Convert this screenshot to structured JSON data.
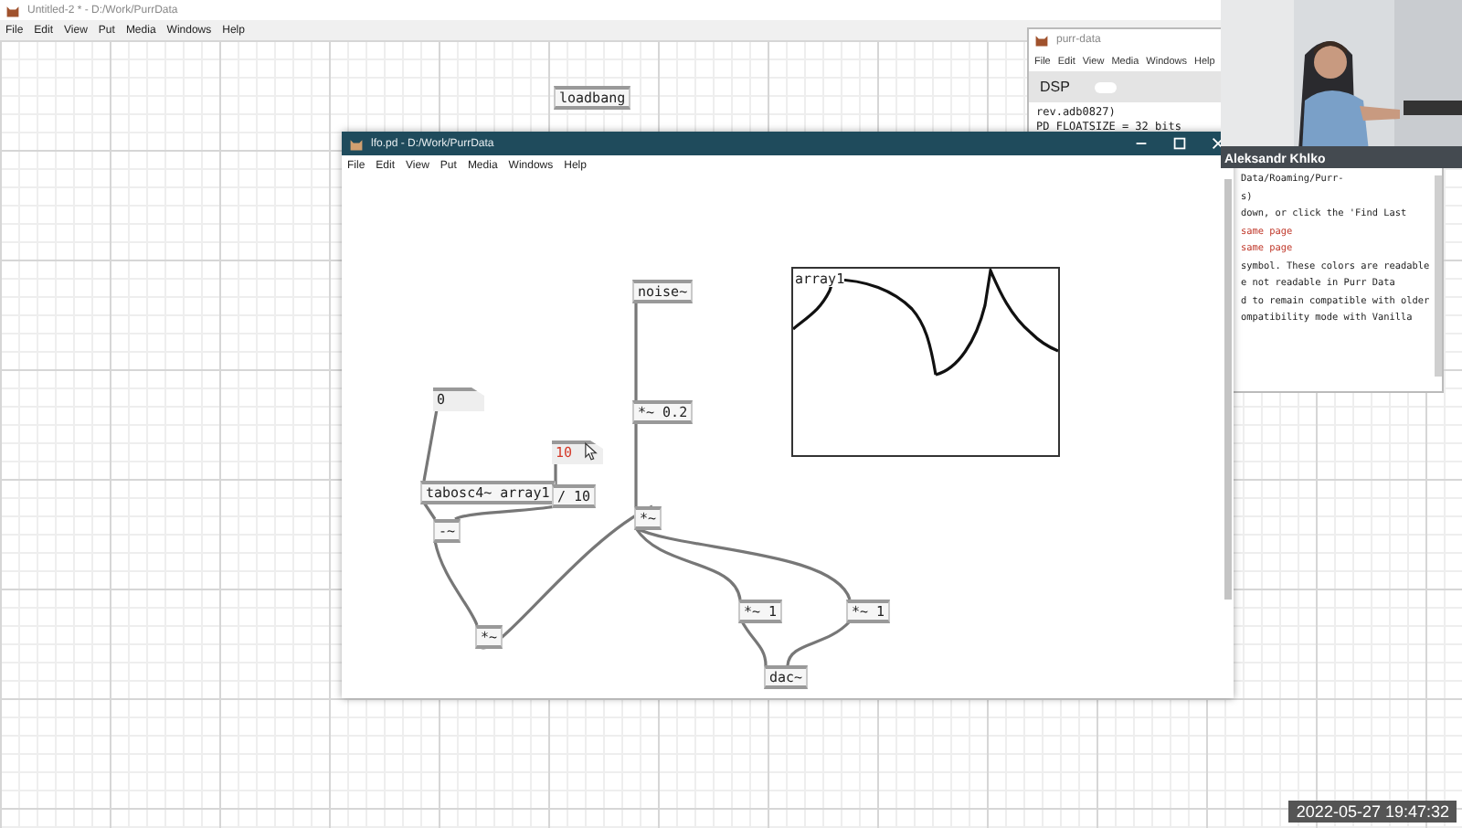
{
  "background_window": {
    "title": "Untitled-2 * - D:/Work/PurrData",
    "menu": [
      "File",
      "Edit",
      "View",
      "Put",
      "Media",
      "Windows",
      "Help"
    ],
    "objects": [
      {
        "kind": "object",
        "text": "loadbang"
      }
    ]
  },
  "console_window": {
    "title": "purr-data",
    "menu": [
      "File",
      "Edit",
      "View",
      "Media",
      "Windows",
      "Help"
    ],
    "dsp": {
      "label": "DSP",
      "on": false
    },
    "left_lines": [
      "rev.adb0827)",
      "PD_FLOATSIZE = 32 bits"
    ],
    "right_lines": [
      {
        "kind": "normal",
        "text": "Data/Roaming/Purr-"
      },
      {
        "kind": "normal",
        "text": "s)"
      },
      {
        "kind": "normal",
        "text": "down, or click the 'Find Last"
      },
      {
        "kind": "error",
        "text": "same page"
      },
      {
        "kind": "error",
        "text": "same page"
      },
      {
        "kind": "normal",
        "text": "symbol. These colors are readable"
      },
      {
        "kind": "normal",
        "text": "e not readable in Purr Data"
      },
      {
        "kind": "normal",
        "text": "d to remain compatible with older"
      },
      {
        "kind": "normal",
        "text": "ompatibility mode with Vanilla"
      }
    ]
  },
  "patch_window": {
    "title": "lfo.pd - D:/Work/PurrData",
    "menu": [
      "File",
      "Edit",
      "View",
      "Put",
      "Media",
      "Windows",
      "Help"
    ],
    "objects": [
      {
        "kind": "object",
        "text": "noise~"
      },
      {
        "kind": "object",
        "text": "*~ 0.2"
      },
      {
        "kind": "number",
        "text": "0",
        "highlighted": false
      },
      {
        "kind": "number",
        "text": "10",
        "highlighted": true
      },
      {
        "kind": "object",
        "text": "tabosc4~ array1"
      },
      {
        "kind": "object",
        "text": "/ 10"
      },
      {
        "kind": "object",
        "text": "-~"
      },
      {
        "kind": "object",
        "text": "*~"
      },
      {
        "kind": "object",
        "text": "*~"
      },
      {
        "kind": "object",
        "text": "*~ 1"
      },
      {
        "kind": "object",
        "text": "*~ 1"
      },
      {
        "kind": "object",
        "text": "dac~"
      }
    ],
    "array": {
      "name": "array1"
    }
  },
  "webcam": {
    "kind": "picture",
    "caption": "Aleksandr Khlko"
  },
  "timestamp": "2022-05-27 19:47:32"
}
